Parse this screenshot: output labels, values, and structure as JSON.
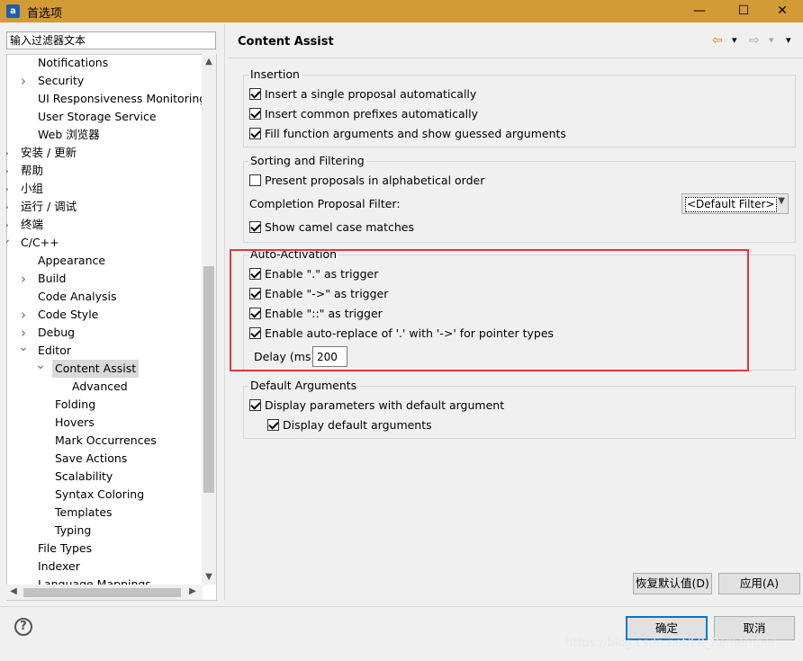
{
  "window": {
    "title": "首选项",
    "app_icon_letter": "a",
    "minimize": "—",
    "maximize": "☐",
    "close": "✕"
  },
  "filter": {
    "placeholder": "输入过滤器文本"
  },
  "tree": {
    "items": [
      {
        "label": "Notifications",
        "level": 2,
        "arrow": ""
      },
      {
        "label": "Security",
        "level": 2,
        "arrow": "right"
      },
      {
        "label": "UI Responsiveness Monitoring",
        "level": 2,
        "arrow": ""
      },
      {
        "label": "User Storage Service",
        "level": 2,
        "arrow": ""
      },
      {
        "label": "Web 浏览器",
        "level": 2,
        "arrow": ""
      },
      {
        "label": "安装 / 更新",
        "level": 1,
        "arrow": "right"
      },
      {
        "label": "帮助",
        "level": 1,
        "arrow": "right"
      },
      {
        "label": "小组",
        "level": 1,
        "arrow": "right"
      },
      {
        "label": "运行 / 调试",
        "level": 1,
        "arrow": "right"
      },
      {
        "label": "终端",
        "level": 1,
        "arrow": "right"
      },
      {
        "label": "C/C++",
        "level": 1,
        "arrow": "down"
      },
      {
        "label": "Appearance",
        "level": 2,
        "arrow": ""
      },
      {
        "label": "Build",
        "level": 2,
        "arrow": "right"
      },
      {
        "label": "Code Analysis",
        "level": 2,
        "arrow": ""
      },
      {
        "label": "Code Style",
        "level": 2,
        "arrow": "right"
      },
      {
        "label": "Debug",
        "level": 2,
        "arrow": "right"
      },
      {
        "label": "Editor",
        "level": 2,
        "arrow": "down"
      },
      {
        "label": "Content Assist",
        "level": 3,
        "arrow": "down",
        "selected": true
      },
      {
        "label": "Advanced",
        "level": 4,
        "arrow": ""
      },
      {
        "label": "Folding",
        "level": 3,
        "arrow": ""
      },
      {
        "label": "Hovers",
        "level": 3,
        "arrow": ""
      },
      {
        "label": "Mark Occurrences",
        "level": 3,
        "arrow": ""
      },
      {
        "label": "Save Actions",
        "level": 3,
        "arrow": ""
      },
      {
        "label": "Scalability",
        "level": 3,
        "arrow": ""
      },
      {
        "label": "Syntax Coloring",
        "level": 3,
        "arrow": ""
      },
      {
        "label": "Templates",
        "level": 3,
        "arrow": ""
      },
      {
        "label": "Typing",
        "level": 3,
        "arrow": ""
      },
      {
        "label": "File Types",
        "level": 2,
        "arrow": ""
      },
      {
        "label": "Indexer",
        "level": 2,
        "arrow": ""
      },
      {
        "label": "Language Mappings",
        "level": 2,
        "arrow": ""
      }
    ]
  },
  "page": {
    "title": "Content Assist",
    "nav_back": "⇦",
    "nav_forward": "⇨",
    "nav_dropdown": "▾",
    "menu": "▾"
  },
  "insertion": {
    "legend": "Insertion",
    "options": [
      {
        "label": "Insert a single proposal automatically",
        "checked": true
      },
      {
        "label": "Insert common prefixes automatically",
        "checked": true
      },
      {
        "label": "Fill function arguments and show guessed arguments",
        "checked": true
      }
    ]
  },
  "sorting": {
    "legend": "Sorting and Filtering",
    "alphabetical": {
      "label": "Present proposals in alphabetical order",
      "checked": false
    },
    "filter_label": "Completion Proposal Filter:",
    "filter_value": "<Default Filter>",
    "camel": {
      "label": "Show camel case matches",
      "checked": true
    }
  },
  "auto_activation": {
    "legend": "Auto-Activation",
    "options": [
      {
        "label": "Enable \".\" as trigger",
        "checked": true
      },
      {
        "label": "Enable \"->\" as trigger",
        "checked": true
      },
      {
        "label": "Enable \"::\" as trigger",
        "checked": true
      },
      {
        "label": "Enable auto-replace of '.' with '->' for pointer types",
        "checked": true
      }
    ],
    "delay_label": "Delay (ms)",
    "delay_value": "200"
  },
  "default_args": {
    "legend": "Default Arguments",
    "display_params": {
      "label": "Display parameters with default argument",
      "checked": true
    },
    "display_defaults": {
      "label": "Display default arguments",
      "checked": true
    }
  },
  "buttons": {
    "restore_defaults": "恢复默认值(D)",
    "apply": "应用(A)",
    "ok": "确定",
    "cancel": "取消"
  },
  "help_icon": "?",
  "watermark": "https://blog.csdn.net/FR_Remember",
  "colors": {
    "titlebar": "#d39b35",
    "highlight_box": "#e03a3a",
    "primary_button_border": "#0078d7"
  }
}
